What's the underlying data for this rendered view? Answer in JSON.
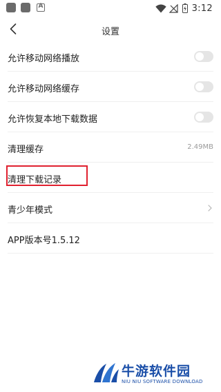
{
  "status_bar": {
    "time": "3:12",
    "notification_icons": [
      "app-icon",
      "app-icon",
      "a-icon"
    ],
    "a_label": "A"
  },
  "header": {
    "title": "设置",
    "back_icon": "chevron-left-icon"
  },
  "settings": [
    {
      "label": "允许移动网络播放",
      "control": "toggle",
      "enabled": false
    },
    {
      "label": "允许移动网络缓存",
      "control": "toggle",
      "enabled": false
    },
    {
      "label": "允许恢复本地下载数据",
      "control": "toggle",
      "enabled": false
    },
    {
      "label": "清理缓存",
      "value": "2.49MB"
    },
    {
      "label": "清理下载记录",
      "highlighted": true
    },
    {
      "label": "青少年模式",
      "control": "chevron-right-icon"
    },
    {
      "label": "APP版本号1.5.12"
    }
  ],
  "watermark": {
    "name": "牛游软件园",
    "subtitle": "NIU NIU SOFTWARE DOWNLOAD"
  },
  "colors": {
    "highlight": "#e0202e",
    "toggle_off": "#e5e5e5",
    "watermark": "#1a4ea8"
  }
}
